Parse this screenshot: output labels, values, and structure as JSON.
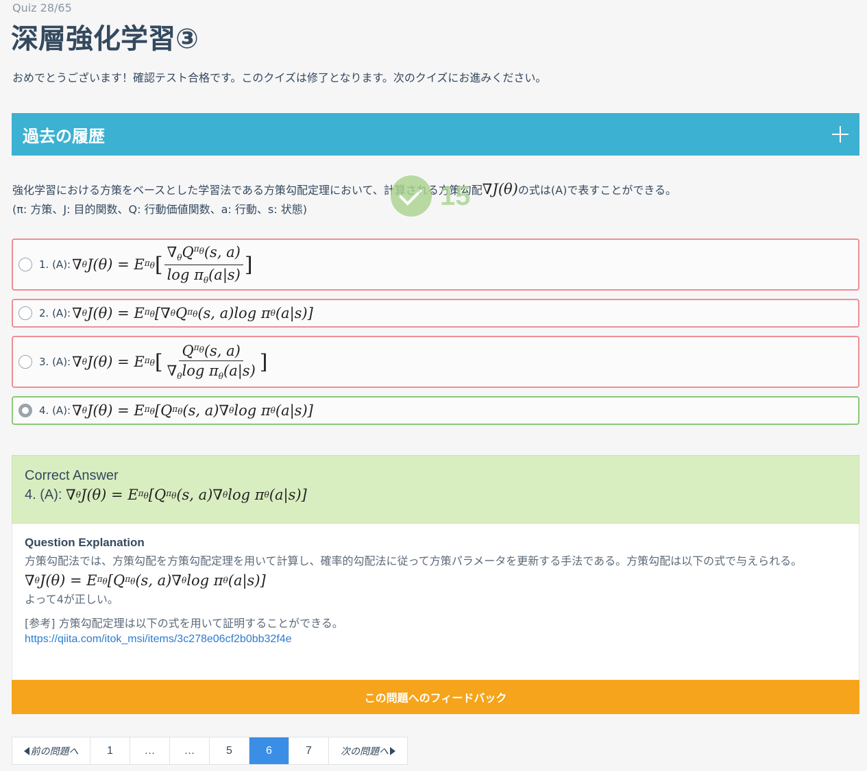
{
  "quiz": {
    "counter": "Quiz 28/65",
    "title": "深層強化学習③",
    "score": "15"
  },
  "congrats": "おめでとうございます！確認テスト合格です。このクイズは修了となります。次のクイズにお進みください。",
  "history": {
    "title": "過去の履歴"
  },
  "question": {
    "text_before": "強化学習における方策をベースとした学習法である方策勾配定理において、計算される方策勾配",
    "text_after": "の式は(A)で表すことができる。",
    "legend": "(π: 方策、J: 目的関数、Q: 行動価値関数、a: 行動、s: 状態)"
  },
  "options": [
    {
      "label": "1. (A):",
      "border": "#ef8d94"
    },
    {
      "label": "2. (A):",
      "border": "#ef8d94"
    },
    {
      "label": "3. (A):",
      "border": "#ef8d94"
    },
    {
      "label": "4. (A):",
      "border": "#8cc879",
      "selected": true
    }
  ],
  "correct": {
    "title": "Correct Answer",
    "label": "4. (A):"
  },
  "explanation": {
    "title": "Question Explanation",
    "body": "方策勾配法では、方策勾配を方策勾配定理を用いて計算し、確率的勾配法に従って方策パラメータを更新する手法である。方策勾配は以下の式で与えられる。",
    "conclusion": "よって4が正しい。",
    "reference": "[参考] 方策勾配定理は以下の式を用いて証明することができる。",
    "link": "https://qiita.com/itok_msi/items/3c278e06cf2b0bb32f4e"
  },
  "feedback_button": "この問題へのフィードバック",
  "pagination": {
    "prev": "前の問題へ",
    "next": "次の問題へ",
    "pages": [
      "1",
      "…",
      "…",
      "5",
      "6",
      "7"
    ],
    "active": "6"
  }
}
